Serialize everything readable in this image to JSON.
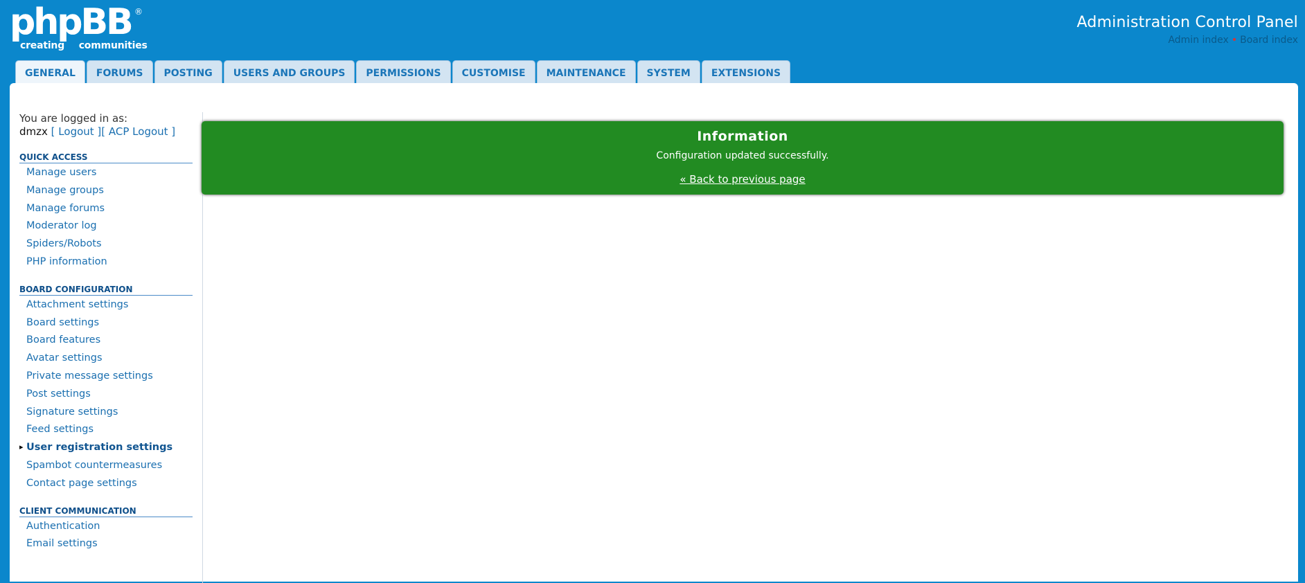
{
  "header": {
    "logo_text": "phpBB",
    "logo_reg": "®",
    "logo_tagline": "creating communities",
    "acp_title": "Administration Control Panel",
    "breadcrumbs": [
      "Admin index",
      "Board index"
    ],
    "breadcrumb_sep": "•"
  },
  "tabs": [
    {
      "label": "GENERAL",
      "active": true
    },
    {
      "label": "FORUMS"
    },
    {
      "label": "POSTING"
    },
    {
      "label": "USERS AND GROUPS"
    },
    {
      "label": "PERMISSIONS"
    },
    {
      "label": "CUSTOMISE"
    },
    {
      "label": "MAINTENANCE"
    },
    {
      "label": "SYSTEM"
    },
    {
      "label": "EXTENSIONS"
    }
  ],
  "sidebar": {
    "logged_in_label": "You are logged in as:",
    "username": "dmzx",
    "logout": "[ Logout ]",
    "acp_logout": "[ ACP Logout ]",
    "sections": [
      {
        "title": "QUICK ACCESS",
        "items": [
          "Manage users",
          "Manage groups",
          "Manage forums",
          "Moderator log",
          "Spiders/Robots",
          "PHP information"
        ]
      },
      {
        "title": "BOARD CONFIGURATION",
        "items": [
          "Attachment settings",
          "Board settings",
          "Board features",
          "Avatar settings",
          "Private message settings",
          "Post settings",
          "Signature settings",
          "Feed settings",
          "User registration settings",
          "Spambot countermeasures",
          "Contact page settings"
        ],
        "active_item": "User registration settings"
      },
      {
        "title": "CLIENT COMMUNICATION",
        "items": [
          "Authentication",
          "Email settings"
        ]
      }
    ]
  },
  "info": {
    "title": "Information",
    "message": "Configuration updated successfully.",
    "back_link": "« Back to previous page",
    "color": "#228b22"
  },
  "colors": {
    "header_bg": "#0b87cc",
    "tab_bg": "#d3e4f2",
    "link": "#1a6fb0"
  }
}
